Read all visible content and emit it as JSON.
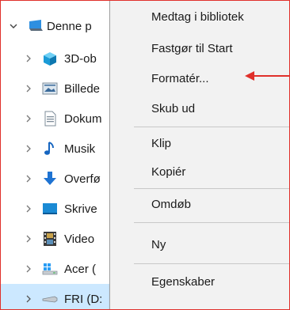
{
  "tree": {
    "root": {
      "label": "Denne p",
      "icon": "this-pc-icon",
      "expanded": true
    },
    "items": [
      {
        "label": "3D-ob",
        "icon": "3d-objects-icon"
      },
      {
        "label": "Billede",
        "icon": "pictures-icon"
      },
      {
        "label": "Dokum",
        "icon": "documents-icon"
      },
      {
        "label": "Musik",
        "icon": "music-icon"
      },
      {
        "label": "Overfø",
        "icon": "downloads-icon"
      },
      {
        "label": "Skrive",
        "icon": "desktop-icon"
      },
      {
        "label": "Video",
        "icon": "videos-icon"
      },
      {
        "label": "Acer (",
        "icon": "windows-drive-icon"
      },
      {
        "label": "FRI (D:",
        "icon": "usb-drive-icon",
        "selected": true
      }
    ]
  },
  "context_menu": {
    "items": [
      {
        "label": "Medtag i bibliotek"
      },
      {
        "label": "Fastgør til Start"
      },
      {
        "label": "Formatér...",
        "highlighted_by_arrow": true
      },
      {
        "label": "Skub ud"
      },
      {
        "label": "Klip"
      },
      {
        "label": "Kopiér"
      },
      {
        "label": "Omdøb"
      },
      {
        "label": "Ny"
      },
      {
        "label": "Egenskaber"
      }
    ]
  },
  "colors": {
    "frame_border": "#e0302b",
    "selection": "#cce8ff",
    "menu_bg": "#f2f2f2",
    "annotation_arrow": "#e0302b"
  }
}
